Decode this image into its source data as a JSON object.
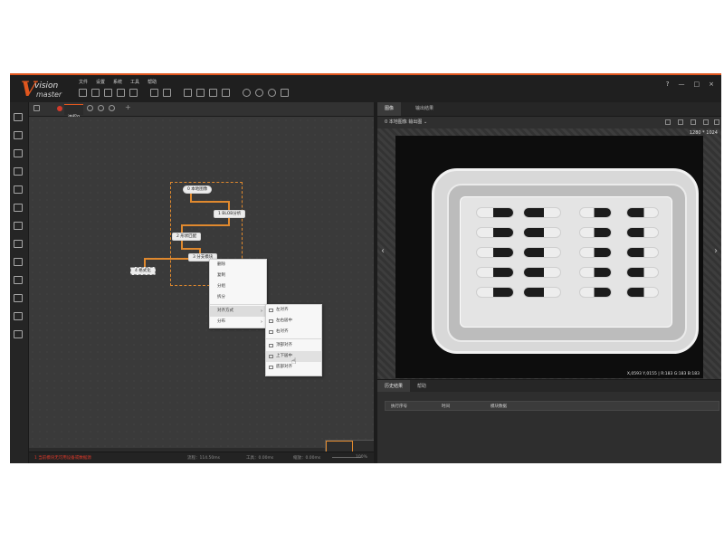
{
  "app": {
    "logo_mark": "V",
    "logo_line1": "vision",
    "logo_line2": "master",
    "menu": [
      "文件",
      "设置",
      "系统",
      "工具",
      "帮助"
    ]
  },
  "window_controls": {
    "help": "?",
    "minimize": "—",
    "restore": "□",
    "close": "×"
  },
  "canvas_tab": {
    "label": "流程0",
    "add": "+"
  },
  "flow_nodes": [
    "0 本地图像",
    "1 BLOB分析",
    "2 形状匹配",
    "3 分支模块",
    "4 格式化"
  ],
  "context_menu": {
    "items": [
      "删除",
      "复制",
      "分组",
      "拆分"
    ],
    "align_label": "对齐方式",
    "distribute_label": "分布"
  },
  "align_submenu": [
    "左对齐",
    "左右居中",
    "右对齐",
    "顶部对齐",
    "上下居中",
    "底部对齐"
  ],
  "status": {
    "error": "1 当前模块无可用设备或数据源",
    "flow_time": "流程：114.50ms",
    "total_time": "工具：0.00ms",
    "zoom_label": "缩放：0.00ms",
    "zoom_value": "100%"
  },
  "right_panel": {
    "tabs": [
      "图像",
      "输出结果"
    ],
    "image_source": "0 本地图像 输出图 ⌄",
    "resolution": "1280 * 1024",
    "pixel_info": "X,0593  Y,0155  |  R:183  G:183  B:183",
    "prev": "‹",
    "next": "›"
  },
  "bottom_panel": {
    "tabs": [
      "历史结果",
      "帮助"
    ],
    "columns": [
      "执行序号",
      "时间",
      "模块数据"
    ]
  },
  "colors": {
    "accent": "#e0561e",
    "wire": "#e0892e",
    "error": "#e0392a"
  }
}
